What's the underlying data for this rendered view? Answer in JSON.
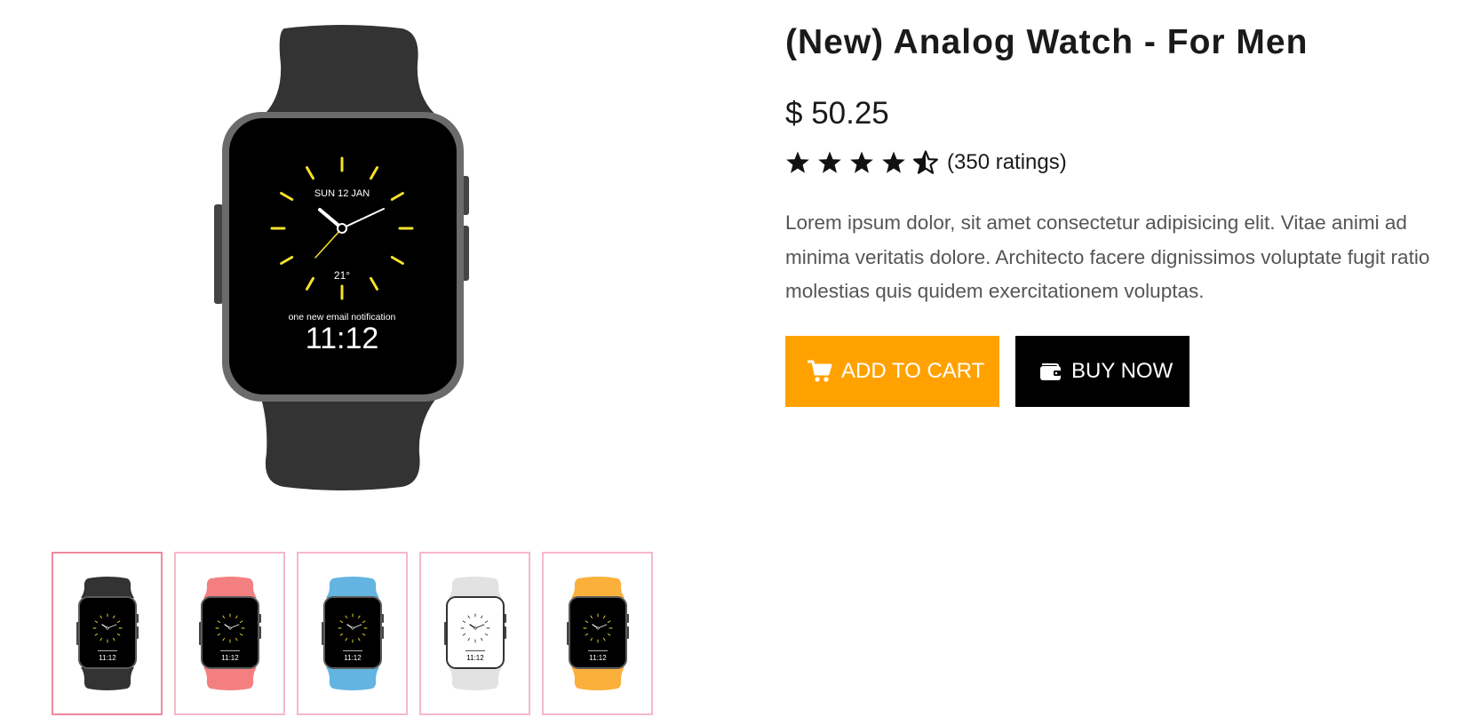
{
  "product": {
    "title": "(New) Analog Watch - For Men",
    "price": "$ 50.25",
    "rating": 4.5,
    "rating_max": 5,
    "ratings_text": "(350 ratings)",
    "description_lines": [
      "Lorem ipsum dolor, sit amet consectetur adipisicing elit. Vitae animi ad",
      "minima veritatis dolore. Architecto facere dignissimos voluptate fugit ratio",
      "molestias quis quidem exercitationem voluptas."
    ]
  },
  "watch_face": {
    "date": "SUN 12 JAN",
    "temperature": "21°",
    "notification": "one new email notification",
    "time": "11:12"
  },
  "thumbnails": [
    {
      "strap_color": "#333333",
      "active": true
    },
    {
      "strap_color": "#f47f80",
      "active": false
    },
    {
      "strap_color": "#63b4e0",
      "active": false
    },
    {
      "strap_color": "#e2e2e2",
      "active": false
    },
    {
      "strap_color": "#fbb03b",
      "active": false
    }
  ],
  "buttons": {
    "add_to_cart": {
      "label": "ADD TO CART",
      "icon": "cart-icon",
      "color": "#ffa200"
    },
    "buy_now": {
      "label": "BUY NOW",
      "icon": "wallet-icon",
      "color": "#000000"
    }
  },
  "colors": {
    "thumb_border": "#f6b8c8",
    "thumb_border_active": "#f0899f",
    "watch_marker": "#f5e12a"
  }
}
